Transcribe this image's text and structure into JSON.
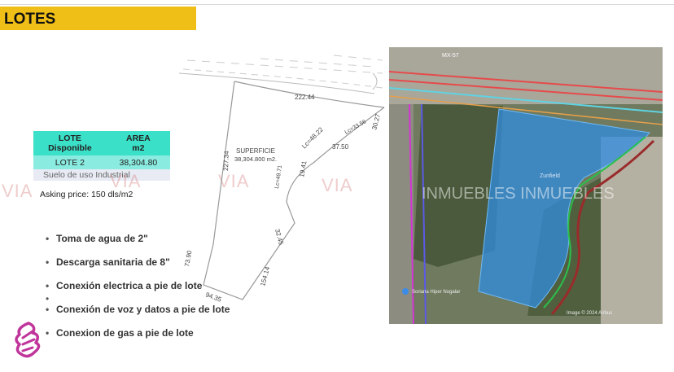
{
  "page": {
    "title": "LOTES"
  },
  "lot_table": {
    "header_lot": "LOTE\nDisponible",
    "header_area": "AREA\nm2",
    "row_lot": "LOTE 2",
    "row_area": "38,304.80",
    "land_use": "Suelo de uso Industrial"
  },
  "asking_price": "Asking price: 150 dls/m2",
  "plot": {
    "superficie_label": "SUPERFICIE",
    "superficie_value": "38,304.800 m2.",
    "dims": {
      "top": "222.44",
      "left": "227.34",
      "left_low": "73.90",
      "bottom": "94.35",
      "right_low": "154.14",
      "mid_a": "32.45",
      "mid_b": "Lc=49.71",
      "mid_c": "19.41",
      "mid_d": "Lc=48.22",
      "mid_e": "37.50",
      "mid_f": "Lc=33.56",
      "mid_g": "30.27"
    }
  },
  "bullets": [
    "Toma de agua de 2\"",
    "Descarga sanitaria de 8\"",
    "Conexión electrica a pie de lote",
    "Conexión de voz y datos a pie de lote",
    "Conexion de gas a pie de lote"
  ],
  "watermark": {
    "brand": "VIA",
    "map_text": "INMUEBLES INMUEBLES"
  },
  "map": {
    "road_label": "MX-57",
    "pin_label": "Soriana Hiper Nogalar",
    "field_label": "Zunfield",
    "credit": "Image © 2024 Airbus",
    "colors": {
      "lot_fill": "#2f8ce0",
      "road_line": "#e64b4b",
      "boundary": "#d235d2",
      "path": "#2bbf4b"
    }
  }
}
